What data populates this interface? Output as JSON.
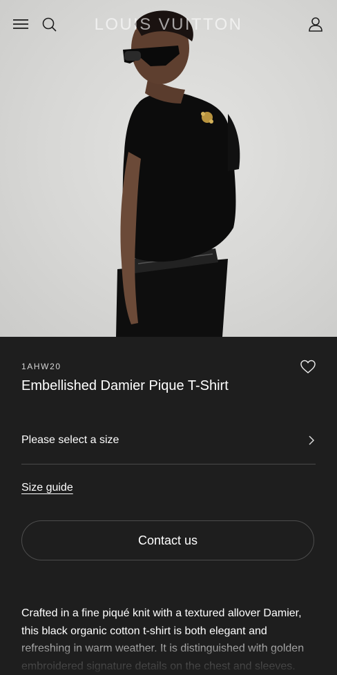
{
  "header": {
    "brand": "LOUIS VUITTON",
    "icons": [
      "menu-icon",
      "search-icon",
      "account-icon"
    ]
  },
  "hero": {
    "image": "model-photo"
  },
  "product": {
    "sku": "1AHW20",
    "name": "Embellished Damier Pique T-Shirt",
    "size_prompt": "Please select a size",
    "size_guide": "Size guide",
    "contact_label": "Contact us",
    "description": "Crafted in a fine piqué knit with a textured allover Damier, this black organic cotton t-shirt is both elegant and refreshing in warm weather. It is distinguished with golden embroidered signature details on the chest and sleeves."
  },
  "colors": {
    "panel_bg": "#1e1e1e",
    "hero_bg": "#d9d9d7",
    "text": "#ffffff",
    "divider": "#4a4a4a"
  }
}
